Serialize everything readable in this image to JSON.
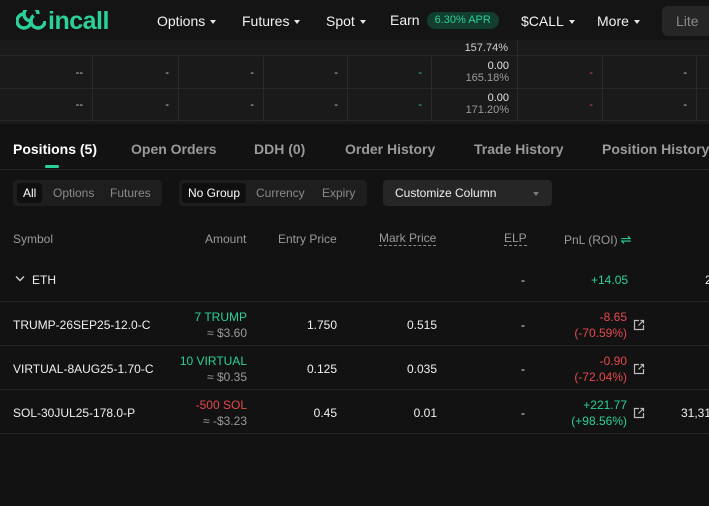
{
  "brand": {
    "name": "incall",
    "color": "#2ad19b"
  },
  "nav": {
    "options": "Options",
    "futures": "Futures",
    "spot": "Spot",
    "earn": "Earn",
    "earn_badge": "6.30% APR",
    "call": "$CALL",
    "more": "More",
    "lite": "Lite"
  },
  "top_table": {
    "partial_above": "157.74%",
    "rows": [
      {
        "c1": "--",
        "c2": "-",
        "c3": "-",
        "c4": "-",
        "c5": "-",
        "v1": "0.00",
        "v2": "165.18%",
        "c7": "-",
        "c8": "-"
      },
      {
        "c1": "--",
        "c2": "-",
        "c3": "-",
        "c4": "-",
        "c5": "-",
        "v1": "0.00",
        "v2": "171.20%",
        "c7": "-",
        "c8": "-"
      }
    ]
  },
  "tabs": {
    "positions": "Positions (5)",
    "open_orders": "Open Orders",
    "ddh": "DDH (0)",
    "order_history": "Order History",
    "trade_history": "Trade History",
    "position_history": "Position History"
  },
  "filters": {
    "type": [
      "All",
      "Options",
      "Futures"
    ],
    "group": [
      "No Group",
      "Currency",
      "Expiry"
    ],
    "customize": "Customize Column"
  },
  "columns": {
    "symbol": "Symbol",
    "amount": "Amount",
    "entry": "Entry Price",
    "mark": "Mark Price",
    "elp": "ELP",
    "pnl": "PnL (ROI)"
  },
  "group": {
    "name": "ETH",
    "elp": "-",
    "pnl": "+14.05",
    "partial": "2"
  },
  "positions": [
    {
      "symbol": "TRUMP-26SEP25-12.0-C",
      "amount": "7 TRUMP",
      "amount_usd": "≈ $3.60",
      "entry": "1.750",
      "mark": "0.515",
      "elp": "-",
      "pnl": "-8.65",
      "roi": "(-70.59%)",
      "side": "long",
      "pnl_sign": "neg",
      "partial": ""
    },
    {
      "symbol": "VIRTUAL-8AUG25-1.70-C",
      "amount": "10 VIRTUAL",
      "amount_usd": "≈ $0.35",
      "entry": "0.125",
      "mark": "0.035",
      "elp": "-",
      "pnl": "-0.90",
      "roi": "(-72.04%)",
      "side": "long",
      "pnl_sign": "neg",
      "partial": ""
    },
    {
      "symbol": "SOL-30JUL25-178.0-P",
      "amount": "-500 SOL",
      "amount_usd": "≈ -$3.23",
      "entry": "0.45",
      "mark": "0.01",
      "elp": "-",
      "pnl": "+221.77",
      "roi": "(+98.56%)",
      "side": "short",
      "pnl_sign": "pos",
      "partial": "31,31"
    }
  ]
}
